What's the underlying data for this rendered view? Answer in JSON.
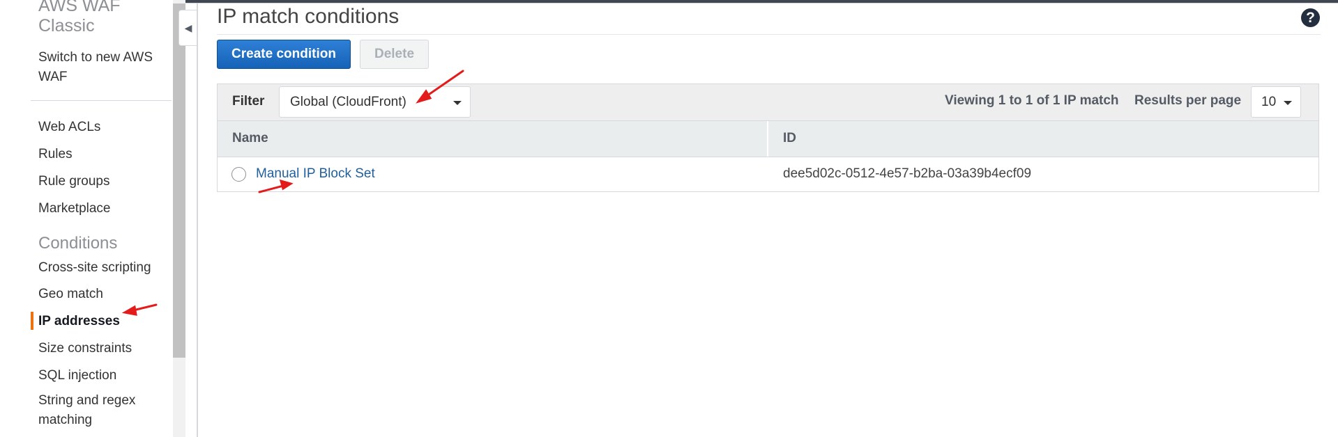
{
  "sidebar": {
    "title": "AWS WAF Classic",
    "switch_link": "Switch to new AWS WAF",
    "items": [
      {
        "label": "Web ACLs"
      },
      {
        "label": "Rules"
      },
      {
        "label": "Rule groups"
      },
      {
        "label": "Marketplace"
      }
    ],
    "conditions_heading": "Conditions",
    "conditions": [
      {
        "label": "Cross-site scripting"
      },
      {
        "label": "Geo match"
      },
      {
        "label": "IP addresses",
        "active": true
      },
      {
        "label": "Size constraints"
      },
      {
        "label": "SQL injection"
      },
      {
        "label": "String and regex matching"
      }
    ],
    "active_color": "#ec7211"
  },
  "main": {
    "title": "IP match conditions",
    "help_icon": "?",
    "create_button": "Create condition",
    "delete_button": "Delete"
  },
  "filter": {
    "label": "Filter",
    "selected": "Global (CloudFront)",
    "viewing_text": "Viewing 1 to 1 of 1 IP match",
    "results_per_page_label": "Results per page",
    "results_per_page": "10"
  },
  "table": {
    "columns": [
      "Name",
      "ID"
    ],
    "rows": [
      {
        "name": "Manual IP Block Set",
        "id": "dee5d02c-0512-4e57-b2ba-03a39b4ecf09"
      }
    ]
  },
  "colors": {
    "primary_button": "#1a6bc4",
    "link": "#1f5f9e",
    "annotation_arrow": "#e31b1b"
  }
}
